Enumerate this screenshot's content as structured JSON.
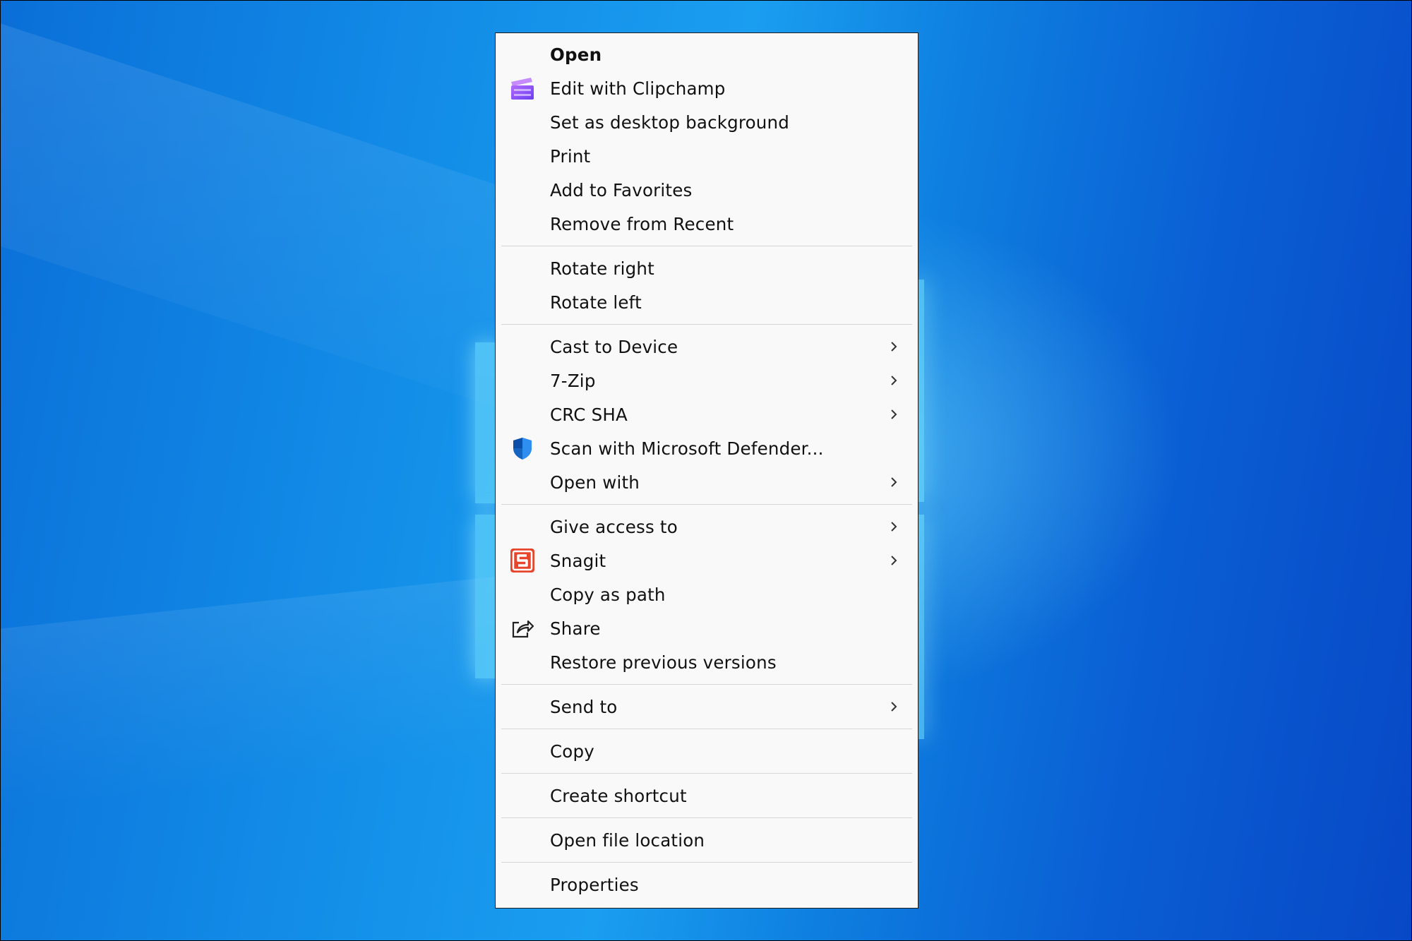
{
  "desktop": {
    "background_colors": [
      "#0a6fd8",
      "#1a9ef0",
      "#0748c6"
    ]
  },
  "context_menu": {
    "groups": [
      [
        {
          "label": "Open",
          "bold": true,
          "icon": null,
          "submenu": false
        },
        {
          "label": "Edit with Clipchamp",
          "icon": "clipchamp-icon",
          "submenu": false
        },
        {
          "label": "Set as desktop background",
          "icon": null,
          "submenu": false
        },
        {
          "label": "Print",
          "icon": null,
          "submenu": false
        },
        {
          "label": "Add to Favorites",
          "icon": null,
          "submenu": false
        },
        {
          "label": "Remove from Recent",
          "icon": null,
          "submenu": false
        }
      ],
      [
        {
          "label": "Rotate right",
          "icon": null,
          "submenu": false
        },
        {
          "label": "Rotate left",
          "icon": null,
          "submenu": false
        }
      ],
      [
        {
          "label": "Cast to Device",
          "icon": null,
          "submenu": true
        },
        {
          "label": "7-Zip",
          "icon": null,
          "submenu": true
        },
        {
          "label": "CRC SHA",
          "icon": null,
          "submenu": true
        },
        {
          "label": "Scan with Microsoft Defender...",
          "icon": "defender-shield-icon",
          "submenu": false
        },
        {
          "label": "Open with",
          "icon": null,
          "submenu": true
        }
      ],
      [
        {
          "label": "Give access to",
          "icon": null,
          "submenu": true
        },
        {
          "label": "Snagit",
          "icon": "snagit-icon",
          "submenu": true
        },
        {
          "label": "Copy as path",
          "icon": null,
          "submenu": false
        },
        {
          "label": "Share",
          "icon": "share-icon",
          "submenu": false
        },
        {
          "label": "Restore previous versions",
          "icon": null,
          "submenu": false
        }
      ],
      [
        {
          "label": "Send to",
          "icon": null,
          "submenu": true
        }
      ],
      [
        {
          "label": "Copy",
          "icon": null,
          "submenu": false
        }
      ],
      [
        {
          "label": "Create shortcut",
          "icon": null,
          "submenu": false
        }
      ],
      [
        {
          "label": "Open file location",
          "icon": null,
          "submenu": false
        }
      ],
      [
        {
          "label": "Properties",
          "icon": null,
          "submenu": false
        }
      ]
    ]
  }
}
